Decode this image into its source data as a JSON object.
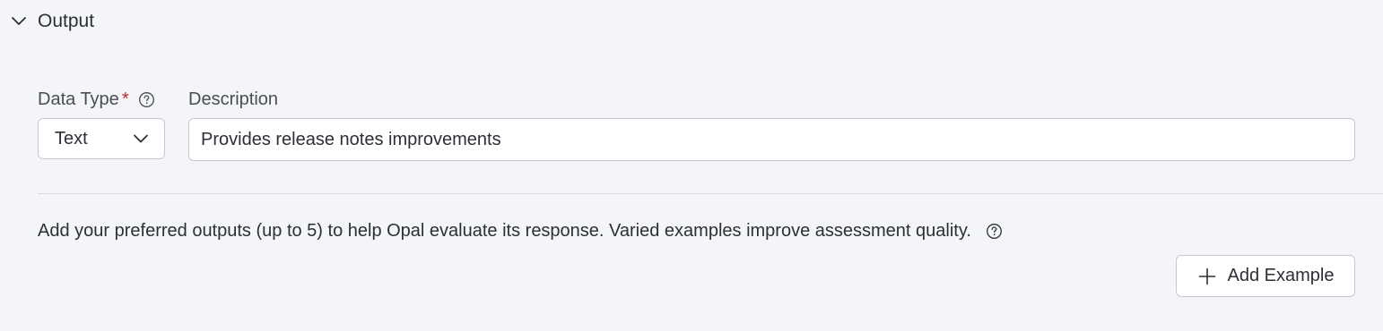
{
  "section": {
    "title": "Output",
    "toggle_icon": "chevron-down-icon"
  },
  "data_type": {
    "label": "Data Type",
    "required_marker": "*",
    "help_icon": "question-circle-icon",
    "selected_value": "Text",
    "dropdown_icon": "chevron-down-icon"
  },
  "description": {
    "label": "Description",
    "value": "Provides release notes improvements"
  },
  "examples": {
    "hint": "Add your preferred outputs (up to 5) to help Opal evaluate its response. Varied examples improve assessment quality.",
    "help_icon": "question-circle-icon",
    "add_button_label": "Add Example",
    "add_icon": "plus-icon"
  },
  "colors": {
    "background": "#f4f5f9",
    "required": "#c2272d",
    "border": "#c7c9d1",
    "text": "#2c2f36"
  }
}
